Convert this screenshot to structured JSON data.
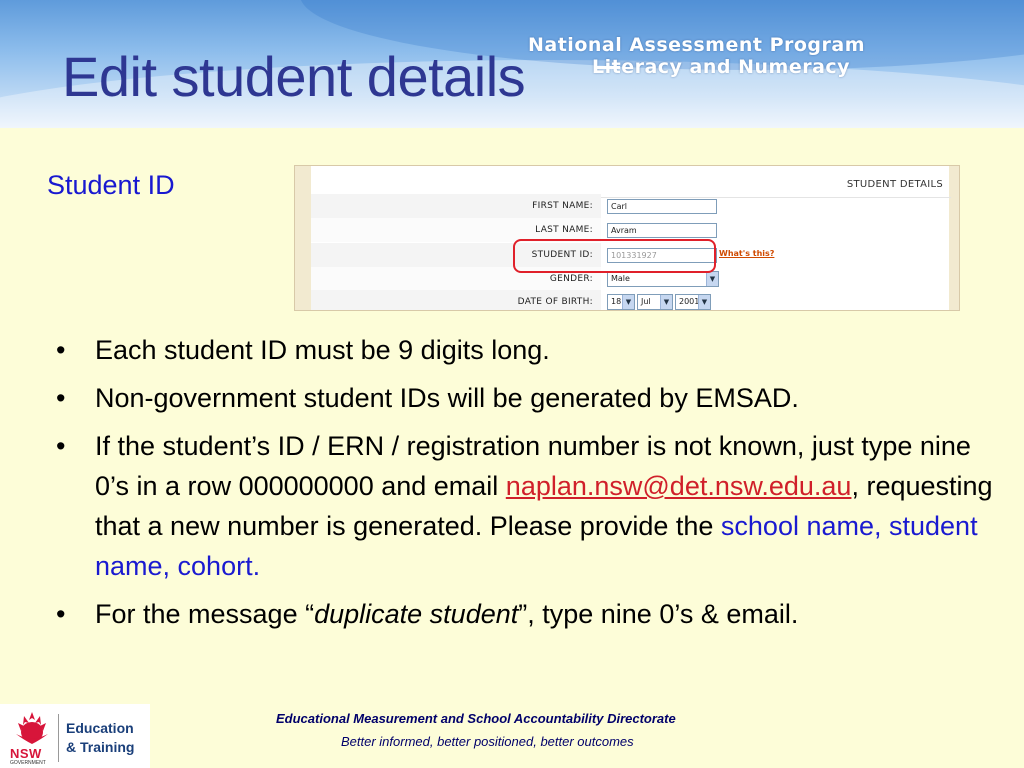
{
  "header": {
    "title": "Edit student details",
    "program_line1": "National Assessment Program",
    "program_line2": "Literacy and Numeracy"
  },
  "section_label": "Student ID",
  "form": {
    "header": "STUDENT DETAILS",
    "first_name_label": "FIRST NAME:",
    "first_name_value": "Carl",
    "last_name_label": "LAST NAME:",
    "last_name_value": "Avram",
    "student_id_label": "STUDENT ID:",
    "student_id_value": "101331927",
    "whats_this": "What's this?",
    "gender_label": "GENDER:",
    "gender_value": "Male",
    "dob_label": "DATE OF BIRTH:",
    "dob_day": "18",
    "dob_month": "Jul",
    "dob_year": "2001"
  },
  "bullets": {
    "b1": "Each student ID must be 9 digits long.",
    "b2": "Non-government student IDs will be generated by EMSAD.",
    "b3_part1": "If the student’s ID / ERN / registration number is not known, just type nine 0’s in a row 000000000 and email ",
    "b3_email": "naplan.nsw@det.nsw.edu.au",
    "b3_part2": ", requesting that a new number is generated. Please provide the ",
    "b3_highlight": "school name, student name, cohort.",
    "b4_part1": "For the message “",
    "b4_italic": "duplicate student",
    "b4_part2": "”, type nine 0’s & email."
  },
  "footer": {
    "logo_nsw": "NSW",
    "logo_gov": "GOVERNMENT",
    "logo_edu1": "Education",
    "logo_edu2": "& Training",
    "line1": "Educational Measurement and School Accountability Directorate",
    "line2": "Better informed, better positioned, better outcomes"
  },
  "colors": {
    "title": "#2e3792",
    "background": "#fdfdd8",
    "section_label": "#1818d0",
    "link": "#d0202a",
    "highlight_box": "#e0202a"
  }
}
